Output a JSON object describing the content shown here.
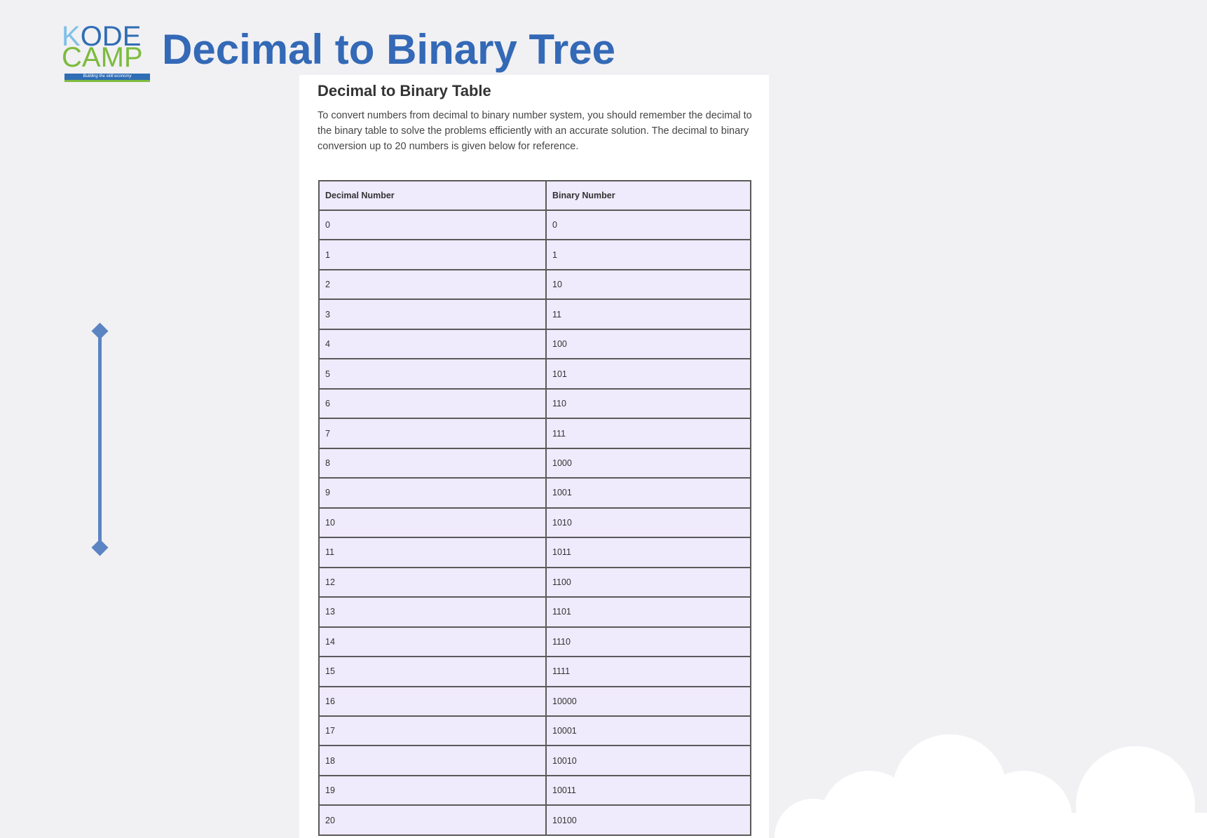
{
  "logo": {
    "line1": "ODE",
    "line1_first": "K",
    "line2": "CAMP",
    "tagline": "Building the skill economy"
  },
  "header": {
    "title": "Decimal to Binary Tree"
  },
  "card": {
    "title": "Decimal to Binary Table",
    "description": "To convert numbers from decimal to binary number system, you should remember the decimal to the binary table to solve the problems efficiently with an accurate solution. The decimal to binary conversion up to 20 numbers is given below for reference.",
    "table": {
      "headers": [
        "Decimal Number",
        "Binary Number"
      ],
      "rows": [
        [
          "0",
          "0"
        ],
        [
          "1",
          "1"
        ],
        [
          "2",
          "10"
        ],
        [
          "3",
          "11"
        ],
        [
          "4",
          "100"
        ],
        [
          "5",
          "101"
        ],
        [
          "6",
          "110"
        ],
        [
          "7",
          "111"
        ],
        [
          "8",
          "1000"
        ],
        [
          "9",
          "1001"
        ],
        [
          "10",
          "1010"
        ],
        [
          "11",
          "1011"
        ],
        [
          "12",
          "1100"
        ],
        [
          "13",
          "1101"
        ],
        [
          "14",
          "1110"
        ],
        [
          "15",
          "1111"
        ],
        [
          "16",
          "10000"
        ],
        [
          "17",
          "10001"
        ],
        [
          "18",
          "10010"
        ],
        [
          "19",
          "10011"
        ],
        [
          "20",
          "10100"
        ]
      ]
    }
  },
  "colors": {
    "title_blue": "#3369b6",
    "logo_green": "#7cbb3e",
    "table_fill": "#efeafc",
    "timeline": "#5b84c3"
  }
}
